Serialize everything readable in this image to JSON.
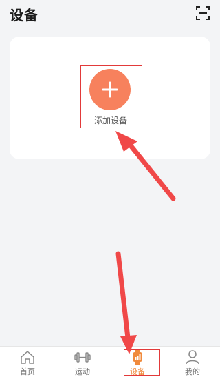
{
  "header": {
    "title": "设备",
    "scan_icon": "scan-icon"
  },
  "card": {
    "add_label": "添加设备",
    "add_icon": "plus-icon",
    "accent": "#f7815d"
  },
  "tabs": [
    {
      "label": "首页",
      "icon": "home-icon",
      "active": false
    },
    {
      "label": "运动",
      "icon": "dumbbell-icon",
      "active": false
    },
    {
      "label": "设备",
      "icon": "watch-icon",
      "active": true
    },
    {
      "label": "我的",
      "icon": "person-icon",
      "active": false
    }
  ],
  "colors": {
    "active_tab": "#f08a3c",
    "annotation_red": "#e23a3a",
    "background": "#f3f4f6"
  }
}
